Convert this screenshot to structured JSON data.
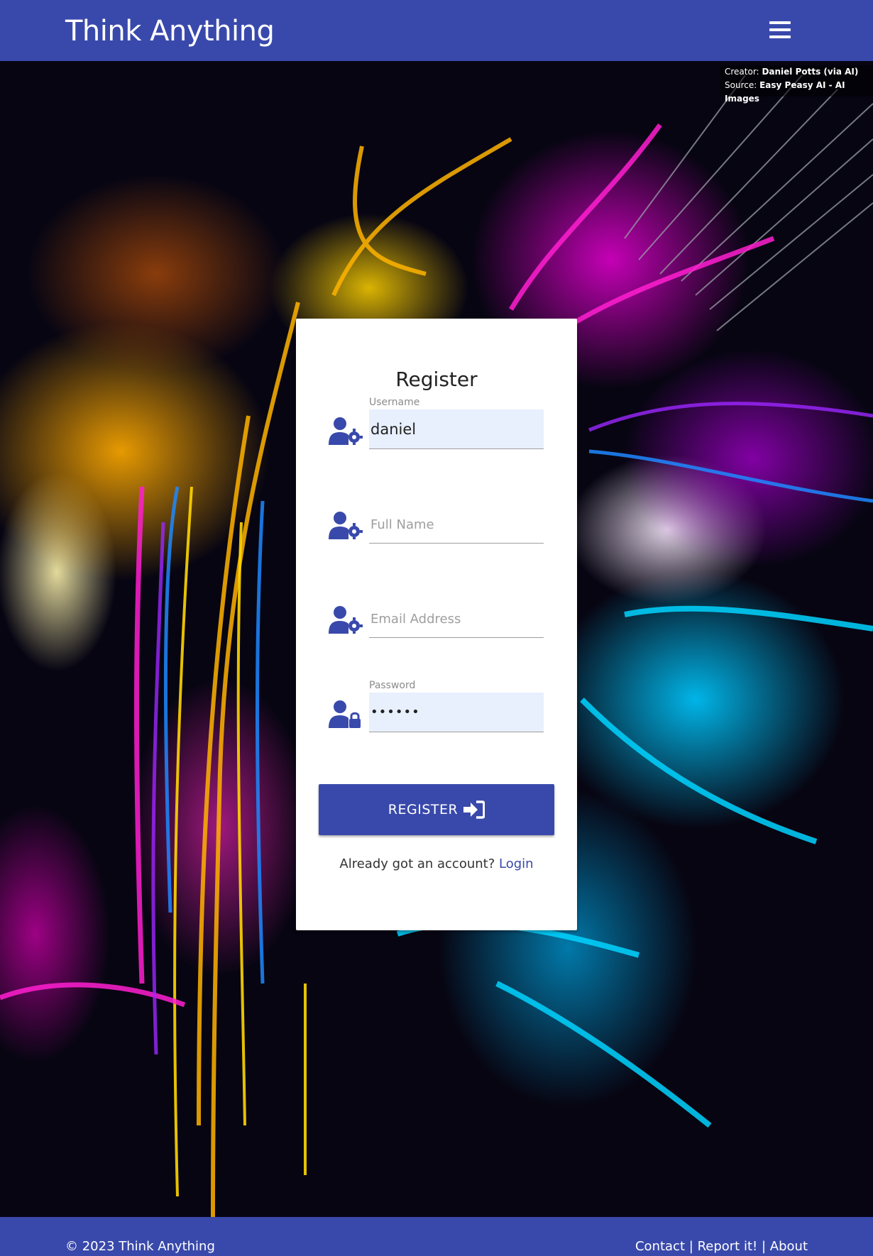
{
  "navbar": {
    "brand": "Think Anything",
    "menu_icon": "hamburger-icon"
  },
  "credit": {
    "creator_label": "Creator:",
    "creator_value": "Daniel Potts (via AI)",
    "source_label": "Source:",
    "source_value": "Easy Peasy AI - AI Images"
  },
  "form": {
    "title": "Register",
    "username": {
      "label": "Username",
      "value": "daniel",
      "icon": "user-gear-icon"
    },
    "fullname": {
      "placeholder": "Full Name",
      "icon": "user-gear-icon"
    },
    "email": {
      "placeholder": "Email Address",
      "icon": "user-gear-icon"
    },
    "password": {
      "label": "Password",
      "value": "••••••",
      "icon": "user-lock-icon"
    },
    "submit_label": "REGISTER",
    "submit_icon": "sign-in-icon",
    "login_prompt": "Already got an account?",
    "login_link": "Login"
  },
  "footer": {
    "copyright": "© 2023 Think Anything",
    "links": [
      "Contact",
      "Report it!",
      "About"
    ],
    "separator": "|"
  },
  "colors": {
    "primary": "#3949ab",
    "autofill": "#e8f0fe"
  }
}
